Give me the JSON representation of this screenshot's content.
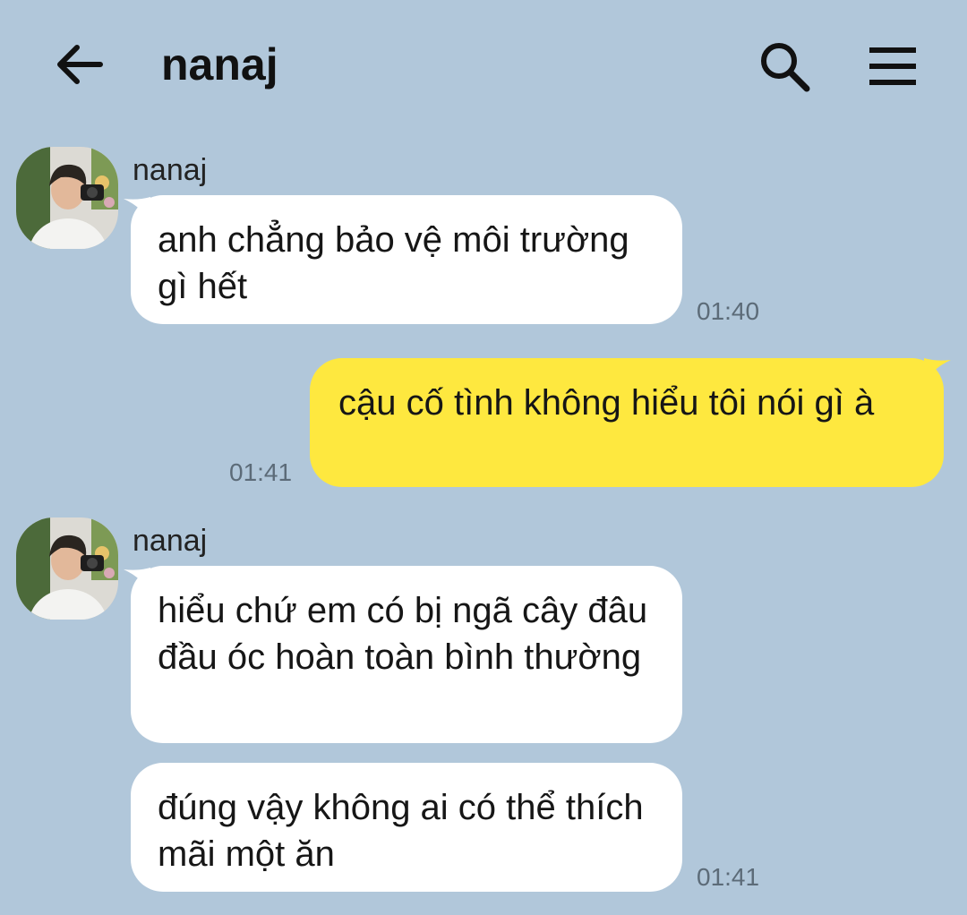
{
  "header": {
    "title": "nanaj",
    "back_icon": "arrow-left-icon",
    "search_icon": "search-icon",
    "menu_icon": "hamburger-menu-icon"
  },
  "colors": {
    "background": "#b1c7da",
    "incoming_bubble": "#ffffff",
    "outgoing_bubble": "#fee83f",
    "timestamp": "#5c6b78"
  },
  "messages": [
    {
      "direction": "incoming",
      "sender": "nanaj",
      "text": "anh chẳng bảo vệ môi trường gì hết",
      "time": "01:40"
    },
    {
      "direction": "outgoing",
      "text": "cậu cố tình không hiểu tôi nói gì à",
      "time": "01:41"
    },
    {
      "direction": "incoming",
      "sender": "nanaj",
      "text": "hiểu chứ em có bị ngã cây đâu đầu óc hoàn toàn bình thường"
    },
    {
      "direction": "incoming",
      "text": "đúng vậy không ai có thể thích mãi một ăn",
      "time": "01:41"
    }
  ]
}
